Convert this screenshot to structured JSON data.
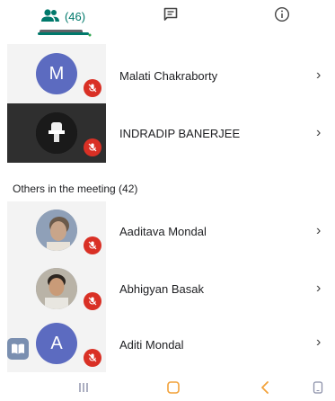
{
  "tabs": {
    "people_count": "(46)",
    "active_color": "#00796b"
  },
  "pinned": [
    {
      "name": "Malati Chakraborty",
      "avatar_letter": "M",
      "avatar_kind": "letter"
    },
    {
      "name": "INDRADIP BANERJEE",
      "avatar_kind": "photo-dark"
    }
  ],
  "section": {
    "title": "Others in the meeting (42)"
  },
  "others": [
    {
      "name": "Aaditava Mondal",
      "avatar_kind": "photo"
    },
    {
      "name": "Abhigyan Basak",
      "avatar_kind": "photo"
    },
    {
      "name": "Aditi Mondal",
      "avatar_letter": "A",
      "avatar_kind": "letter"
    }
  ],
  "icons": {
    "people": "people-icon",
    "chat": "chat-icon",
    "info": "info-icon",
    "mic_off": "mic-off-icon",
    "chevron": "chevron-right-icon",
    "nav_recents": "recents-icon",
    "nav_home": "home-icon",
    "nav_back": "back-icon",
    "nav_screen": "screen-icon"
  },
  "colors": {
    "accent": "#00796b",
    "avatar_bg": "#5c6bc0",
    "mute_red": "#d93025",
    "nav_home": "#f2a23a",
    "nav_back": "#f2a23a"
  }
}
